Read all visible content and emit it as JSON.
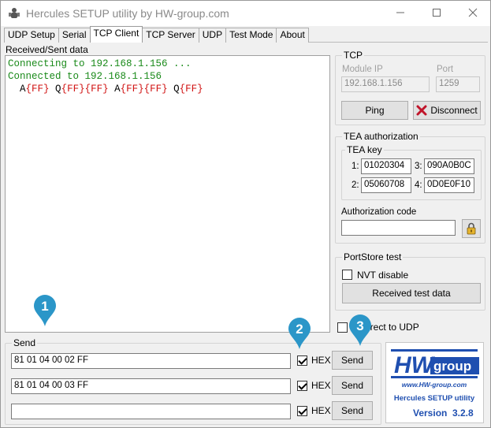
{
  "window": {
    "title": "Hercules SETUP utility by HW-group.com"
  },
  "tabs": [
    {
      "label": "UDP Setup"
    },
    {
      "label": "Serial"
    },
    {
      "label": "TCP Client"
    },
    {
      "label": "TCP Server"
    },
    {
      "label": "UDP"
    },
    {
      "label": "Test Mode"
    },
    {
      "label": "About"
    }
  ],
  "received": {
    "label": "Received/Sent data",
    "lines": [
      "Connecting to 192.168.1.156 ...",
      "Connected to 192.168.1.156"
    ],
    "sequence": [
      {
        "ch": "A",
        "hex": "{FF}"
      },
      {
        "ch": "Q",
        "hex": "{FF}{FF}"
      },
      {
        "ch": "A",
        "hex": "{FF}{FF}"
      },
      {
        "ch": "Q",
        "hex": "{FF}"
      }
    ]
  },
  "tcp": {
    "title": "TCP",
    "module_ip_label": "Module IP",
    "module_ip": "192.168.1.156",
    "port_label": "Port",
    "port": "1259",
    "ping_label": "Ping",
    "disconnect_label": "Disconnect"
  },
  "tea": {
    "title": "TEA authorization",
    "key_title": "TEA key",
    "keys": [
      {
        "n": "1:",
        "value": "01020304"
      },
      {
        "n": "3:",
        "value": "090A0B0C"
      },
      {
        "n": "2:",
        "value": "05060708"
      },
      {
        "n": "4:",
        "value": "0D0E0F10"
      }
    ],
    "auth_code_label": "Authorization code",
    "auth_code": ""
  },
  "portstore": {
    "title": "PortStore test",
    "nvt_label": "NVT disable",
    "nvt_checked": false,
    "received_btn_label": "Received test data"
  },
  "redirect": {
    "label": "Redirect to UDP",
    "checked": false
  },
  "send": {
    "title": "Send",
    "rows": [
      {
        "value": "81 01 04 00 02 FF",
        "hex_label": "HEX",
        "hex_checked": true,
        "button": "Send"
      },
      {
        "value": "81 01 04 00 03 FF",
        "hex_label": "HEX",
        "hex_checked": true,
        "button": "Send"
      },
      {
        "value": "",
        "hex_label": "HEX",
        "hex_checked": true,
        "button": "Send"
      }
    ]
  },
  "callouts": [
    "1",
    "2",
    "3"
  ],
  "logo": {
    "brand_hw": "HW",
    "brand_group": "group",
    "url": "www.HW-group.com",
    "product": "Hercules SETUP utility",
    "version_label": "Version",
    "version": "3.2.8"
  },
  "colors": {
    "connect_text": "#1a8a1a",
    "hex_text": "#d01010",
    "callout": "#2b96c8",
    "logo_blue": "#1f4fb0"
  }
}
